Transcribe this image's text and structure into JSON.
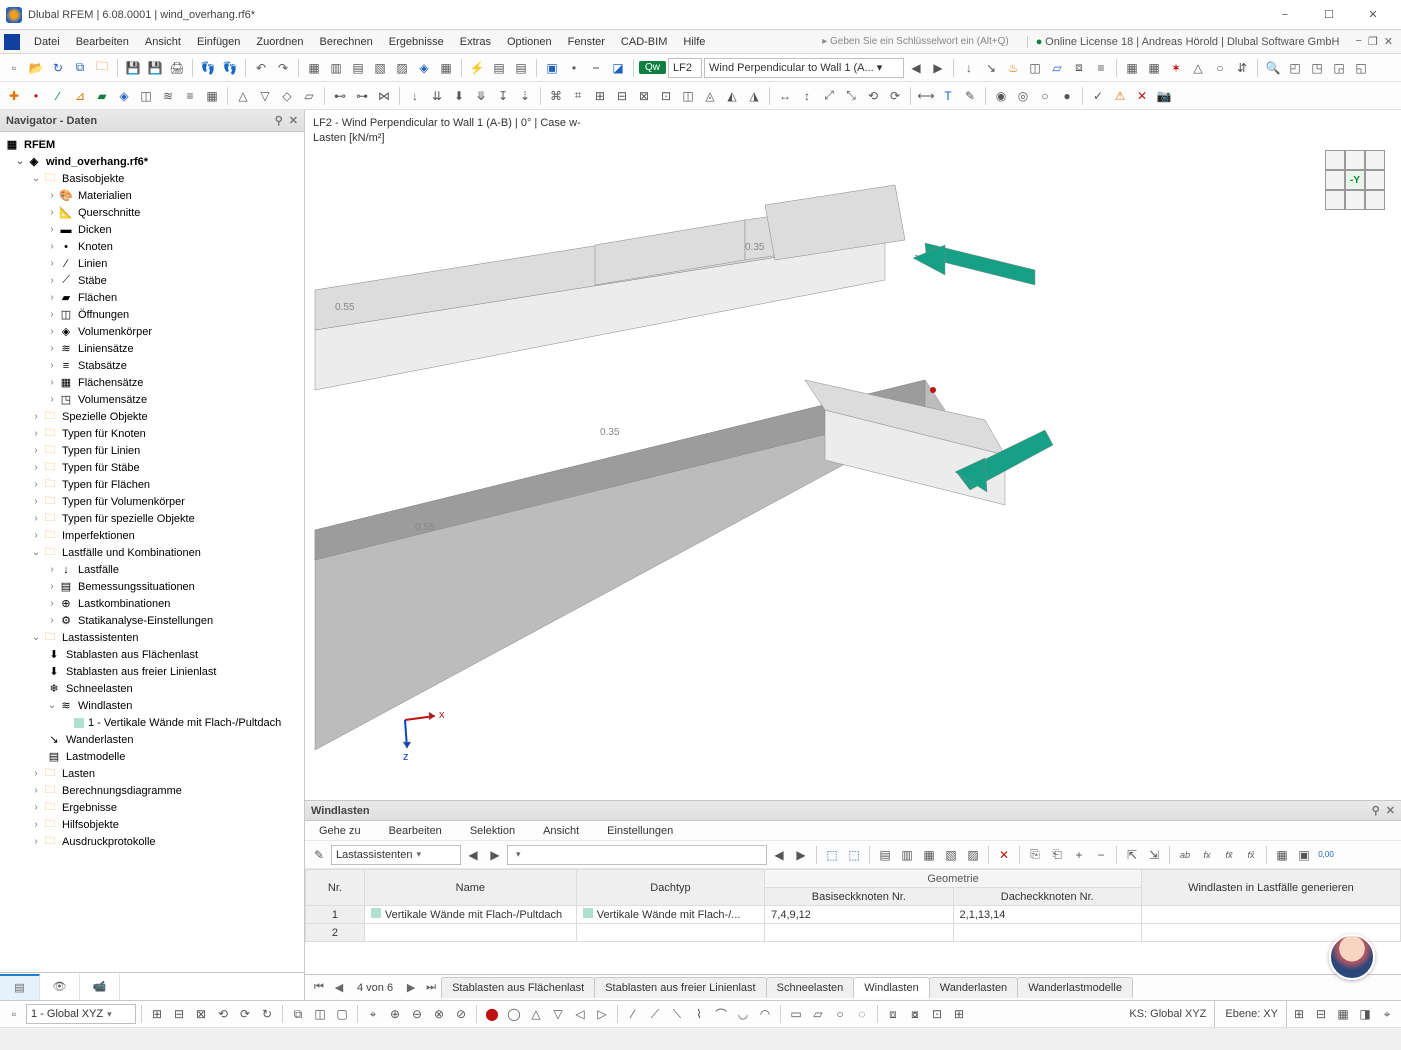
{
  "window": {
    "title": "Dlubal RFEM | 6.08.0001 | wind_overhang.rf6*",
    "license": "Online License 18 | Andreas Hörold | Dlubal Software GmbH",
    "keyword_hint": "▸ Geben Sie ein Schlüsselwort ein (Alt+Q)"
  },
  "menus": [
    "Datei",
    "Bearbeiten",
    "Ansicht",
    "Einfügen",
    "Zuordnen",
    "Berechnen",
    "Ergebnisse",
    "Extras",
    "Optionen",
    "Fenster",
    "CAD-BIM",
    "Hilfe"
  ],
  "lf_chip": "Qw",
  "lf_label": "LF2",
  "lf_dropdown": "Wind Perpendicular to Wall 1 (A... ▾",
  "viewport": {
    "title_line1": "LF2 - Wind Perpendicular to Wall 1 (A-B) | 0° | Case w-",
    "title_line2": "Lasten [kN/m²]",
    "orient_label": "-Y",
    "labels": {
      "a": "0.35",
      "b": "0.55",
      "c": "0.35",
      "d": "0.55"
    },
    "axes": {
      "x": "x",
      "z": "z"
    }
  },
  "navigator": {
    "title": "Navigator - Daten",
    "root": "RFEM",
    "file": "wind_overhang.rf6*",
    "basis": "Basisobjekte",
    "basis_children": [
      "Materialien",
      "Querschnitte",
      "Dicken",
      "Knoten",
      "Linien",
      "Stäbe",
      "Flächen",
      "Öffnungen",
      "Volumenkörper",
      "Liniensätze",
      "Stabsätze",
      "Flächensätze",
      "Volumensätze"
    ],
    "folders_mid": [
      "Spezielle Objekte",
      "Typen für Knoten",
      "Typen für Linien",
      "Typen für Stäbe",
      "Typen für Flächen",
      "Typen für Volumenkörper",
      "Typen für spezielle Objekte",
      "Imperfektionen"
    ],
    "lf_combo": "Lastfälle und Kombinationen",
    "lf_children": [
      "Lastfälle",
      "Bemessungssituationen",
      "Lastkombinationen",
      "Statikanalyse-Einstellungen"
    ],
    "assist": "Lastassistenten",
    "assist_children": [
      "Stablasten aus Flächenlast",
      "Stablasten aus freier Linienlast",
      "Schneelasten"
    ],
    "wind": "Windlasten",
    "wind_child": "1 - Vertikale Wände mit Flach-/Pultdach",
    "assist_tail": [
      "Wanderlasten",
      "Lastmodelle"
    ],
    "folders_end": [
      "Lasten",
      "Berechnungsdiagramme",
      "Ergebnisse",
      "Hilfsobjekte",
      "Ausdruckprotokolle"
    ]
  },
  "bottom": {
    "title": "Windlasten",
    "menus": [
      "Gehe zu",
      "Bearbeiten",
      "Selektion",
      "Ansicht",
      "Einstellungen"
    ],
    "tool_drop": "Lastassistenten",
    "headers": {
      "nr": "Nr.",
      "name": "Name",
      "dach": "Dachtyp",
      "geom": "Geometrie",
      "beck": "Basiseckknoten Nr.",
      "deck": "Dacheckknoten Nr.",
      "gen": "Windlasten in Lastfälle generieren"
    },
    "row": {
      "nr": "1",
      "name": "Vertikale Wände mit Flach-/Pultdach",
      "dach": "Vertikale Wände mit Flach-/...",
      "beck": "7,4,9,12",
      "deck": "2,1,13,14",
      "gen": ""
    },
    "row2_nr": "2",
    "page_info": "4 von 6",
    "tabs": [
      "Stablasten aus Flächenlast",
      "Stablasten aus freier Linienlast",
      "Schneelasten",
      "Windlasten",
      "Wanderlasten",
      "Wanderlastmodelle"
    ],
    "active_tab": 3
  },
  "status": {
    "cs_drop": "1 - Global XYZ",
    "ks": "KS: Global XYZ",
    "ebene": "Ebene: XY"
  }
}
